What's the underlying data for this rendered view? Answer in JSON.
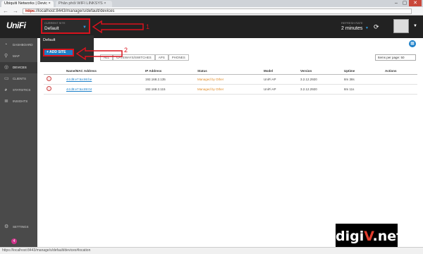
{
  "browser": {
    "tabs": [
      {
        "title": "Ubiquiti Networks | Devic ×"
      },
      {
        "title": "Phân phối WIFI LINKSYS ×"
      }
    ],
    "url_proto": "https",
    "url_rest": "://localhost:8443/manage/s/default/devices",
    "status_url": "https://localhost:8443/manage/s/default/devices#location"
  },
  "header": {
    "logo": "UniFi",
    "site_label": "CURRENT SITE",
    "site_value": "Default",
    "refresh_label": "REFRESH RATE",
    "refresh_value": "2 minutes"
  },
  "dropdown": {
    "option": "Default",
    "add_site": "+ ADD SITE"
  },
  "sidebar": {
    "items": [
      {
        "label": "DASHBOARD",
        "icon": "gauge-icon"
      },
      {
        "label": "MAP",
        "icon": "map-pin-icon"
      },
      {
        "label": "DEVICES",
        "icon": "devices-icon"
      },
      {
        "label": "CLIENTS",
        "icon": "clients-icon"
      },
      {
        "label": "STATISTICS",
        "icon": "pie-chart-icon"
      },
      {
        "label": "INSIGHTS",
        "icon": "list-icon"
      },
      {
        "label": "SETTINGS",
        "icon": "gear-icon"
      }
    ],
    "notification_count": "4"
  },
  "filters": [
    "ALL",
    "GATEWAYS/SWITCHES",
    "APS",
    "PHONES"
  ],
  "per_page": "Items per page: 50",
  "table": {
    "headers": [
      "Name/MAC Address",
      "IP Address",
      "Status",
      "Model",
      "Version",
      "Uptime",
      "Actions"
    ],
    "rows": [
      {
        "mac": "44:d9:e7:6a:86:be",
        "ip": "192.168.2.135",
        "status": "Managed by Other",
        "model": "UniFi AP",
        "version": "3.2.12.2920",
        "uptime": "8m 38s"
      },
      {
        "mac": "44:d9:e7:6a:89:04",
        "ip": "192.168.2.115",
        "status": "Managed by Other",
        "model": "UniFi AP",
        "version": "3.2.12.2920",
        "uptime": "8m 11s"
      }
    ]
  },
  "annotations": {
    "one": "1",
    "two": "2"
  },
  "watermark": {
    "a": "digi",
    "b": "V",
    "c": ".net"
  }
}
